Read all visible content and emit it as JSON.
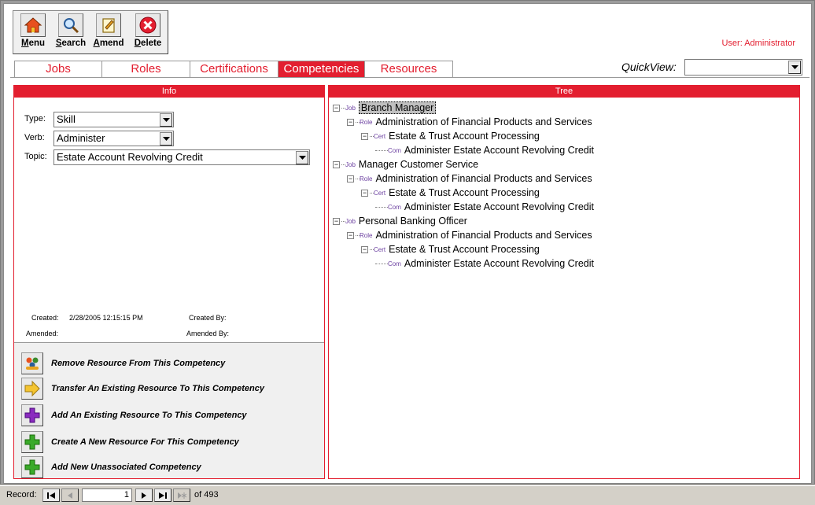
{
  "toolbar": {
    "buttons": [
      {
        "key": "M",
        "rest": "enu",
        "icon": "home-icon"
      },
      {
        "key": "S",
        "rest": "earch",
        "icon": "search-icon"
      },
      {
        "key": "A",
        "rest": "mend",
        "icon": "amend-icon"
      },
      {
        "key": "D",
        "rest": "elete",
        "icon": "delete-icon"
      }
    ]
  },
  "user_label": "User: Administrator",
  "tabs": [
    "Jobs",
    "Roles",
    "Certifications",
    "Competencies",
    "Resources"
  ],
  "active_tab": "Competencies",
  "quickview": {
    "label": "QuickView:",
    "value": ""
  },
  "info": {
    "title": "Info",
    "type_label": "Type:",
    "type_value": "Skill",
    "verb_label": "Verb:",
    "verb_value": "Administer",
    "topic_label": "Topic:",
    "topic_value": "Estate Account Revolving Credit",
    "created_label": "Created:",
    "created_value": "2/28/2005 12:15:15 PM",
    "created_by_label": "Created By:",
    "amended_label": "Amended:",
    "amended_by_label": "Amended By:"
  },
  "actions": [
    {
      "label": "Remove Resource From This Competency",
      "icon": "people-icon"
    },
    {
      "label": "Transfer An Existing Resource To This Competency",
      "icon": "arrow-right-icon"
    },
    {
      "label": "Add An Existing Resource To This Competency",
      "icon": "plus-purple-icon"
    },
    {
      "label": "Create A New Resource For This Competency",
      "icon": "plus-green-icon"
    },
    {
      "label": "Add New Unassociated Competency",
      "icon": "plus-green-icon"
    }
  ],
  "tree": {
    "title": "Tree",
    "nodes": [
      {
        "tag": "Job",
        "text": "Branch Manager",
        "level": 0,
        "selected": true
      },
      {
        "tag": "Role",
        "text": "Administration of Financial Products and Services",
        "level": 1
      },
      {
        "tag": "Cert",
        "text": "Estate & Trust Account Processing",
        "level": 2
      },
      {
        "tag": "Com",
        "text": "Administer Estate Account Revolving Credit",
        "level": 3
      },
      {
        "tag": "Job",
        "text": "Manager Customer Service",
        "level": 0
      },
      {
        "tag": "Role",
        "text": "Administration of Financial Products and Services",
        "level": 1
      },
      {
        "tag": "Cert",
        "text": "Estate & Trust Account Processing",
        "level": 2
      },
      {
        "tag": "Com",
        "text": "Administer Estate Account Revolving Credit",
        "level": 3
      },
      {
        "tag": "Job",
        "text": "Personal Banking Officer",
        "level": 0
      },
      {
        "tag": "Role",
        "text": "Administration of Financial Products and Services",
        "level": 1
      },
      {
        "tag": "Cert",
        "text": "Estate & Trust Account Processing",
        "level": 2
      },
      {
        "tag": "Com",
        "text": "Administer Estate Account Revolving Credit",
        "level": 3
      }
    ]
  },
  "status": {
    "record_label": "Record:",
    "record_value": "1",
    "of_text": "of",
    "total": "493"
  },
  "colors": {
    "accent": "#e31e2f",
    "tree_tag": "#6b3fa0"
  }
}
